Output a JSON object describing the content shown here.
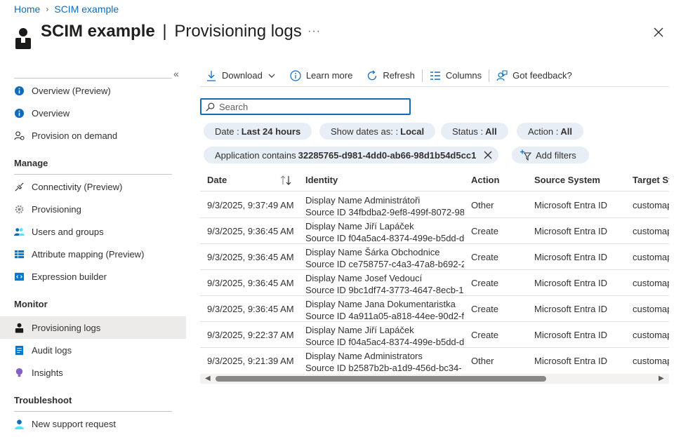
{
  "breadcrumb": {
    "home": "Home",
    "current": "SCIM example"
  },
  "header": {
    "title": "SCIM example",
    "separator": "|",
    "subtitle": "Provisioning logs",
    "more": "···"
  },
  "sidebar": {
    "top_items": [
      {
        "label": "Overview (Preview)",
        "icon": "info-icon"
      },
      {
        "label": "Overview",
        "icon": "info-icon"
      },
      {
        "label": "Provision on demand",
        "icon": "user-sync-icon"
      }
    ],
    "sections": {
      "manage": "Manage",
      "monitor": "Monitor",
      "troubleshoot": "Troubleshoot"
    },
    "manage_items": [
      {
        "label": "Connectivity (Preview)",
        "icon": "plug-icon"
      },
      {
        "label": "Provisioning",
        "icon": "gear-icon"
      },
      {
        "label": "Users and groups",
        "icon": "users-icon"
      },
      {
        "label": "Attribute mapping (Preview)",
        "icon": "table-icon"
      },
      {
        "label": "Expression builder",
        "icon": "code-icon"
      }
    ],
    "monitor_items": [
      {
        "label": "Provisioning logs",
        "icon": "person-icon",
        "active": true
      },
      {
        "label": "Audit logs",
        "icon": "log-icon"
      },
      {
        "label": "Insights",
        "icon": "bulb-icon"
      }
    ],
    "troubleshoot_items": [
      {
        "label": "New support request",
        "icon": "support-icon"
      }
    ]
  },
  "toolbar": {
    "download": "Download",
    "learn_more": "Learn more",
    "refresh": "Refresh",
    "columns": "Columns",
    "feedback": "Got feedback?"
  },
  "search": {
    "placeholder": "Search"
  },
  "filters": {
    "date_label": "Date :",
    "date_value": "Last 24 hours",
    "show_dates_label": "Show dates as: :",
    "show_dates_value": "Local",
    "status_label": "Status :",
    "status_value": "All",
    "action_label": "Action :",
    "action_value": "All",
    "app_label": "Application contains",
    "app_value": "32285765-d981-4dd0-ab66-98d1b54d5cc1",
    "add_filters": "Add filters"
  },
  "table": {
    "columns": [
      "Date",
      "Identity",
      "Action",
      "Source System",
      "Target Sy"
    ],
    "rows": [
      {
        "date": "9/3/2025, 9:37:49 AM",
        "name": "Display Name Administrátoři",
        "source": "Source ID 34fbdba2-9ef8-499f-8072-98",
        "action": "Other",
        "source_system": "Microsoft Entra ID",
        "target": "customap"
      },
      {
        "date": "9/3/2025, 9:36:45 AM",
        "name": "Display Name Jiří Lapáček",
        "source": "Source ID f04a5ac4-8374-499e-b5dd-d",
        "action": "Create",
        "source_system": "Microsoft Entra ID",
        "target": "customap"
      },
      {
        "date": "9/3/2025, 9:36:45 AM",
        "name": "Display Name Šárka Obchodnice",
        "source": "Source ID ce758757-c4a3-47a8-b692-2",
        "action": "Create",
        "source_system": "Microsoft Entra ID",
        "target": "customap"
      },
      {
        "date": "9/3/2025, 9:36:45 AM",
        "name": "Display Name Josef Vedoucí",
        "source": "Source ID 9bc1df74-3773-4647-8ecb-1",
        "action": "Create",
        "source_system": "Microsoft Entra ID",
        "target": "customap"
      },
      {
        "date": "9/3/2025, 9:36:45 AM",
        "name": "Display Name Jana Dokumentaristka",
        "source": "Source ID 4a911a05-a818-44ee-90d2-f",
        "action": "Create",
        "source_system": "Microsoft Entra ID",
        "target": "customap"
      },
      {
        "date": "9/3/2025, 9:22:37 AM",
        "name": "Display Name Jiří Lapáček",
        "source": "Source ID f04a5ac4-8374-499e-b5dd-d",
        "action": "Create",
        "source_system": "Microsoft Entra ID",
        "target": "customap"
      },
      {
        "date": "9/3/2025, 9:21:39 AM",
        "name": "Display Name Administrators",
        "source": "Source ID b2587b2b-a1d9-456d-bc34-",
        "action": "Other",
        "source_system": "Microsoft Entra ID",
        "target": "customap"
      }
    ]
  },
  "colors": {
    "accent": "#0f6cbd",
    "pill_bg": "#e8eef6",
    "active_bg": "#edebe9"
  }
}
